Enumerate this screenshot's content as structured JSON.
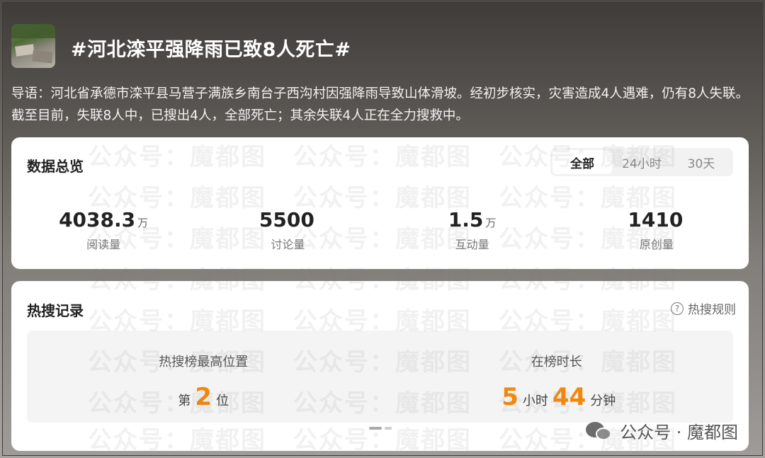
{
  "header": {
    "title": "#河北滦平强降雨已致8人死亡#",
    "intro": "导语：河北省承德市滦平县马营子满族乡南台子西沟村因强降雨导致山体滑坡。经初步核实，灾害造成4人遇难，仍有8人失联。截至目前，失联8人中，已搜出4人，全部死亡；其余失联4人正在全力搜救中。"
  },
  "overview": {
    "title": "数据总览",
    "tabs": [
      {
        "label": "全部",
        "active": true
      },
      {
        "label": "24小时",
        "active": false
      },
      {
        "label": "30天",
        "active": false
      }
    ],
    "stats": [
      {
        "value": "4038.3",
        "unit": "万",
        "label": "阅读量"
      },
      {
        "value": "5500",
        "unit": "",
        "label": "讨论量"
      },
      {
        "value": "1.5",
        "unit": "万",
        "label": "互动量"
      },
      {
        "value": "1410",
        "unit": "",
        "label": "原创量"
      }
    ]
  },
  "hot_search": {
    "title": "热搜记录",
    "rules_label": "热搜规则",
    "best_position": {
      "caption": "热搜榜最高位置",
      "prefix": "第",
      "value": "2",
      "suffix": "位"
    },
    "duration": {
      "caption": "在榜时长",
      "hours": "5",
      "hours_unit": "小时",
      "minutes": "44",
      "minutes_unit": "分钟"
    }
  },
  "watermark": {
    "text": "公众号：魔都图",
    "footer_label": "公众号 · 魔都图"
  },
  "colors": {
    "accent": "#f5880c"
  }
}
